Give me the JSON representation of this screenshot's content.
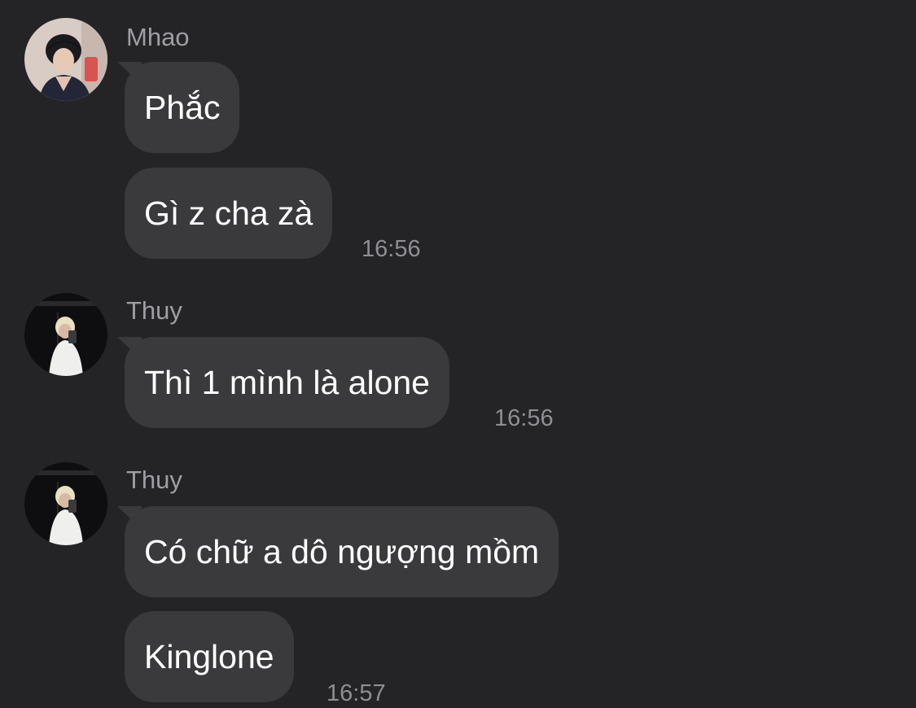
{
  "messages": [
    {
      "sender": "Mhao",
      "avatar_icon": "profile-photo-mhao",
      "bubbles": [
        "Phắc",
        "Gì z cha zà"
      ],
      "time": "16:56"
    },
    {
      "sender": "Thuy",
      "avatar_icon": "profile-photo-thuy",
      "bubbles": [
        "Thì 1 mình là alone"
      ],
      "time": "16:56"
    },
    {
      "sender": "Thuy",
      "avatar_icon": "profile-photo-thuy",
      "bubbles": [
        "Có chữ a dô ngượng mồm",
        "Kinglone"
      ],
      "time": "16:57"
    }
  ],
  "colors": {
    "background": "#242426",
    "bubble": "#3a3a3c",
    "text": "#ffffff",
    "meta": "#8e8e93"
  }
}
